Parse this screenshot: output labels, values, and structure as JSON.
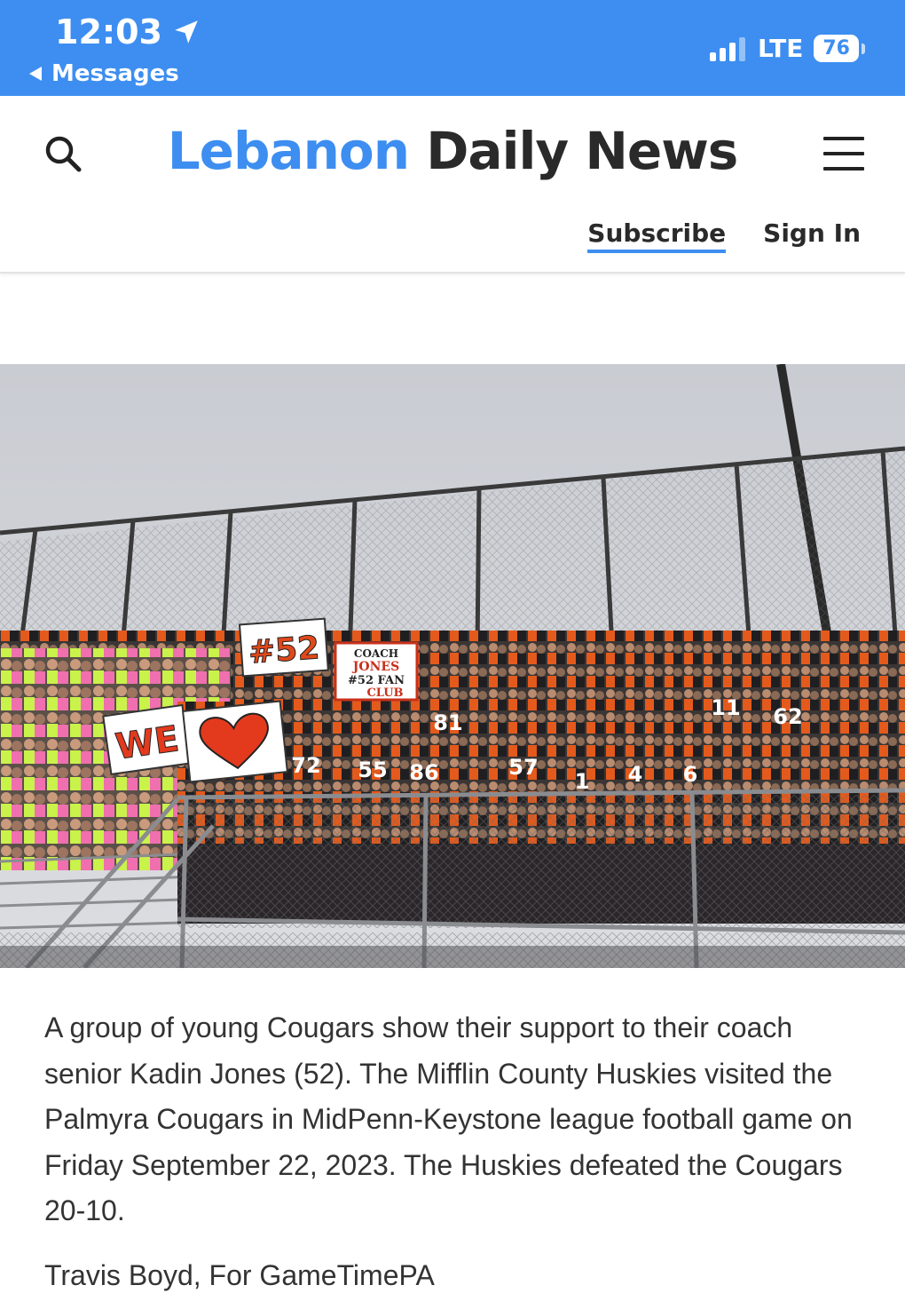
{
  "status_bar": {
    "time": "12:03",
    "back_label": "Messages",
    "network": "LTE",
    "battery": "76",
    "background_color": "#3d8ef0",
    "signal_bars": 3,
    "signal_bars_total": 4
  },
  "header": {
    "logo_part1": "Lebanon",
    "logo_part2": "Daily News",
    "logo_accent_color": "#3d8ef0",
    "subscribe_label": "Subscribe",
    "signin_label": "Sign In",
    "search_icon": "search-icon",
    "menu_icon": "hamburger-menu-icon"
  },
  "photo": {
    "signs": {
      "number_sign": "#52",
      "fan_club_sign_line1": "COACH",
      "fan_club_sign_line2": "JONES",
      "fan_club_sign_line3": "#52 FAN",
      "fan_club_sign_line4": "CLUB",
      "we_sign": "WE"
    },
    "jersey_numbers": [
      "72",
      "55",
      "86",
      "57",
      "1",
      "4",
      "6",
      "81",
      "11",
      "62"
    ]
  },
  "article": {
    "caption": "A group of young Cougars show their support to their coach senior Kadin Jones (52). The Mifflin County Huskies visited the Palmyra Cougars in MidPenn-Keystone league football game on Friday September 22, 2023. The Huskies defeated the Cougars 20-10.",
    "credit": "Travis Boyd, For GameTimePA"
  }
}
